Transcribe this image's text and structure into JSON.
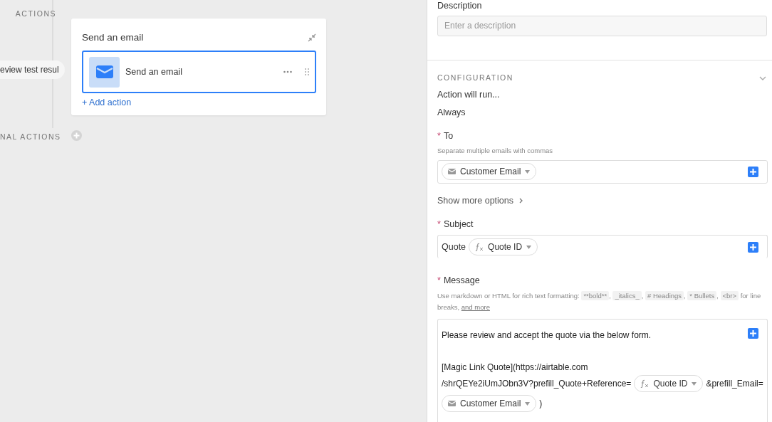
{
  "canvas": {
    "actions_label": "ACTIONS",
    "trigger_pill": "eview test resul",
    "conditional_label": "NAL ACTIONS",
    "card": {
      "title": "Send an email",
      "action": {
        "label": "Send an email",
        "selected": true
      },
      "add_action": "+ Add action"
    }
  },
  "panel": {
    "description": {
      "label": "Description",
      "placeholder": "Enter a description"
    },
    "configuration": {
      "heading": "CONFIGURATION",
      "expanded": true,
      "run_label": "Action will run...",
      "run_value": "Always",
      "to": {
        "required_mark": "*",
        "label": "To",
        "hint": "Separate multiple emails with commas",
        "tokens": [
          {
            "kind": "email",
            "label": "Customer Email"
          }
        ]
      },
      "more_options": "Show more options",
      "subject": {
        "required_mark": "*",
        "label": "Subject",
        "segments": [
          {
            "kind": "text",
            "text": "Quote"
          },
          {
            "kind": "formula",
            "label": "Quote ID"
          }
        ]
      },
      "message": {
        "required_mark": "*",
        "label": "Message",
        "hint": [
          {
            "kind": "text",
            "text": "Use markdown or HTML for rich text formatting:"
          },
          {
            "kind": "code",
            "text": "**bold**"
          },
          {
            "kind": "text",
            "text": ","
          },
          {
            "kind": "code",
            "text": "_italics_"
          },
          {
            "kind": "text",
            "text": ","
          },
          {
            "kind": "code",
            "text": "# Headings"
          },
          {
            "kind": "text",
            "text": ","
          },
          {
            "kind": "code",
            "text": "* Bullets"
          },
          {
            "kind": "text",
            "text": ","
          },
          {
            "kind": "code",
            "text": "<br>"
          },
          {
            "kind": "text",
            "text": "for line breaks,"
          },
          {
            "kind": "link",
            "text": "and more"
          }
        ],
        "lines": [
          {
            "gap_before": false,
            "segments": [
              {
                "kind": "text",
                "text": "Please review and accept the quote via the below form."
              }
            ]
          },
          {
            "gap_before": true,
            "segments": [
              {
                "kind": "text",
                "text": "[Magic Link Quote](https://airtable.com"
              }
            ]
          },
          {
            "gap_before": false,
            "segments": [
              {
                "kind": "text",
                "text": "/shrQEYe2iUmJObn3V?prefill_Quote+Reference="
              },
              {
                "kind": "formula",
                "label": "Quote ID"
              },
              {
                "kind": "text",
                "text": "&prefill_Email="
              }
            ]
          },
          {
            "gap_before": false,
            "segments": [
              {
                "kind": "email",
                "label": "Customer Email"
              },
              {
                "kind": "text",
                "text": ")"
              }
            ]
          }
        ]
      }
    }
  }
}
